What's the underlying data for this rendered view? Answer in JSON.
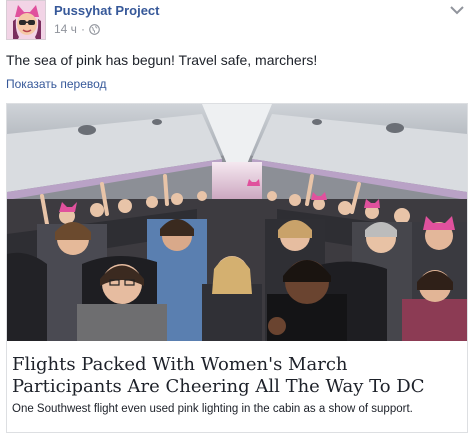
{
  "header": {
    "page_name": "Pussyhat Project",
    "timestamp": "14 ч",
    "separator": "·",
    "privacy_icon": "globe-icon",
    "menu_icon": "chevron-down-icon"
  },
  "post": {
    "text": "The sea of pink has begun! Travel safe, marchers!",
    "see_translation": "Показать перевод"
  },
  "link_card": {
    "image_subject": "airplane-cabin-passengers-photo",
    "title": "Flights Packed With Women's March Participants Are Cheering All The Way To DC",
    "description": "One Southwest flight even used pink lighting in the cabin as a show of support."
  },
  "colors": {
    "link_blue": "#365899",
    "meta_gray": "#90949c",
    "text": "#1d2129",
    "card_border": "#dddfe2",
    "pink_hat": "#e0519d"
  }
}
